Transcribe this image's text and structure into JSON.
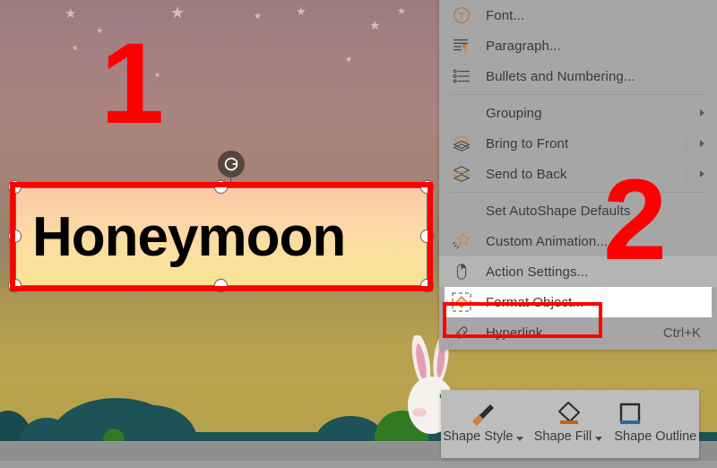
{
  "slide": {
    "shape": {
      "text": "Honeymoon",
      "fill_gradient_start": "#fbc9a4",
      "fill_gradient_end": "#f9e293",
      "rotate_handle_icon": "rotate-icon"
    },
    "background": {
      "sky_top_color": "#9b7b80",
      "ground_color": "#b5a04c",
      "bush_color": "#1d5257"
    }
  },
  "annotations": {
    "step_one": "1",
    "step_two": "2",
    "highlight_color": "#fe0000"
  },
  "context_menu": {
    "items": [
      {
        "label": "Font...",
        "icon": "font-icon",
        "shortcut": "",
        "submenu": false,
        "state": "normal"
      },
      {
        "label": "Paragraph...",
        "icon": "paragraph-icon",
        "shortcut": "",
        "submenu": false,
        "state": "normal"
      },
      {
        "label": "Bullets and Numbering...",
        "icon": "bullets-numbering-icon",
        "shortcut": "",
        "submenu": false,
        "state": "normal"
      },
      {
        "label": "Grouping",
        "icon": "",
        "shortcut": "",
        "submenu": true,
        "state": "normal"
      },
      {
        "label": "Bring to Front",
        "icon": "bring-to-front-icon",
        "shortcut": "",
        "submenu": true,
        "state": "normal"
      },
      {
        "label": "Send to Back",
        "icon": "send-to-back-icon",
        "shortcut": "",
        "submenu": true,
        "state": "normal"
      },
      {
        "label": "Set AutoShape Defaults",
        "icon": "",
        "shortcut": "",
        "submenu": false,
        "state": "normal"
      },
      {
        "label": "Custom Animation...",
        "icon": "custom-animation-icon",
        "shortcut": "",
        "submenu": false,
        "state": "normal"
      },
      {
        "label": "Action Settings...",
        "icon": "action-settings-icon",
        "shortcut": "",
        "submenu": false,
        "state": "highlight"
      },
      {
        "label": "Format Object...",
        "icon": "format-object-icon",
        "shortcut": "",
        "submenu": false,
        "state": "selected"
      },
      {
        "label": "Hyperlink...",
        "icon": "hyperlink-icon",
        "shortcut": "Ctrl+K",
        "submenu": false,
        "state": "normal"
      }
    ]
  },
  "mini_toolbar": {
    "buttons": [
      {
        "label": "Shape Style",
        "icon": "shape-style-icon",
        "has_caret": true
      },
      {
        "label": "Shape Fill",
        "icon": "shape-fill-icon",
        "has_caret": true
      },
      {
        "label": "Shape Outline",
        "icon": "shape-outline-icon",
        "has_caret": false
      }
    ]
  }
}
